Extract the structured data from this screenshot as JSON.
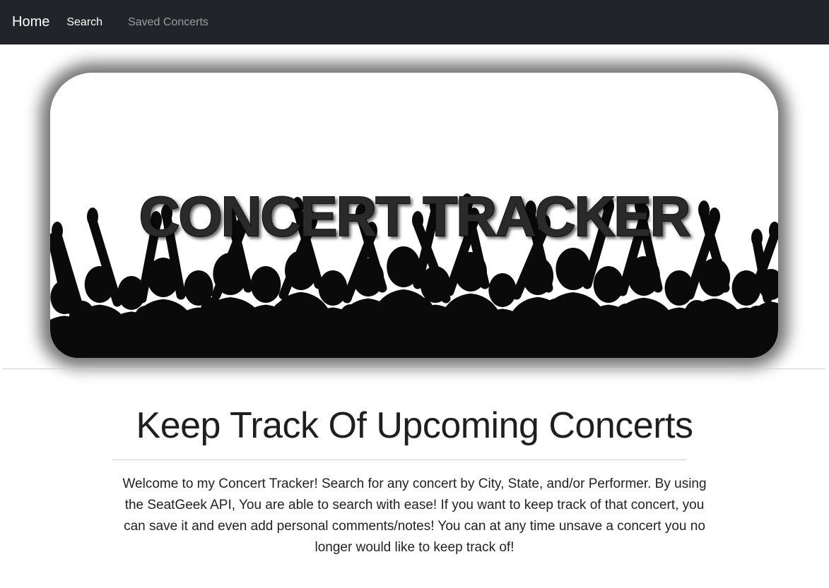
{
  "navbar": {
    "brand": "Home",
    "links": [
      {
        "label": "Search",
        "active": true
      },
      {
        "label": "Saved Concerts",
        "active": false
      }
    ],
    "background": "#212529"
  },
  "hero": {
    "title": "CONCERT TRACKER",
    "title_color": "#222222",
    "image": "crowd-silhouette"
  },
  "main": {
    "heading": "Keep Track Of Upcoming Concerts",
    "description": "Welcome to my Concert Tracker! Search for any concert by City, State, and/or Performer. By using the SeatGeek API, You are able to search with ease! If you want to keep track of that concert, you can save it and even add personal comments/notes! You can at any time unsave a concert you no longer would like to keep track of!"
  }
}
